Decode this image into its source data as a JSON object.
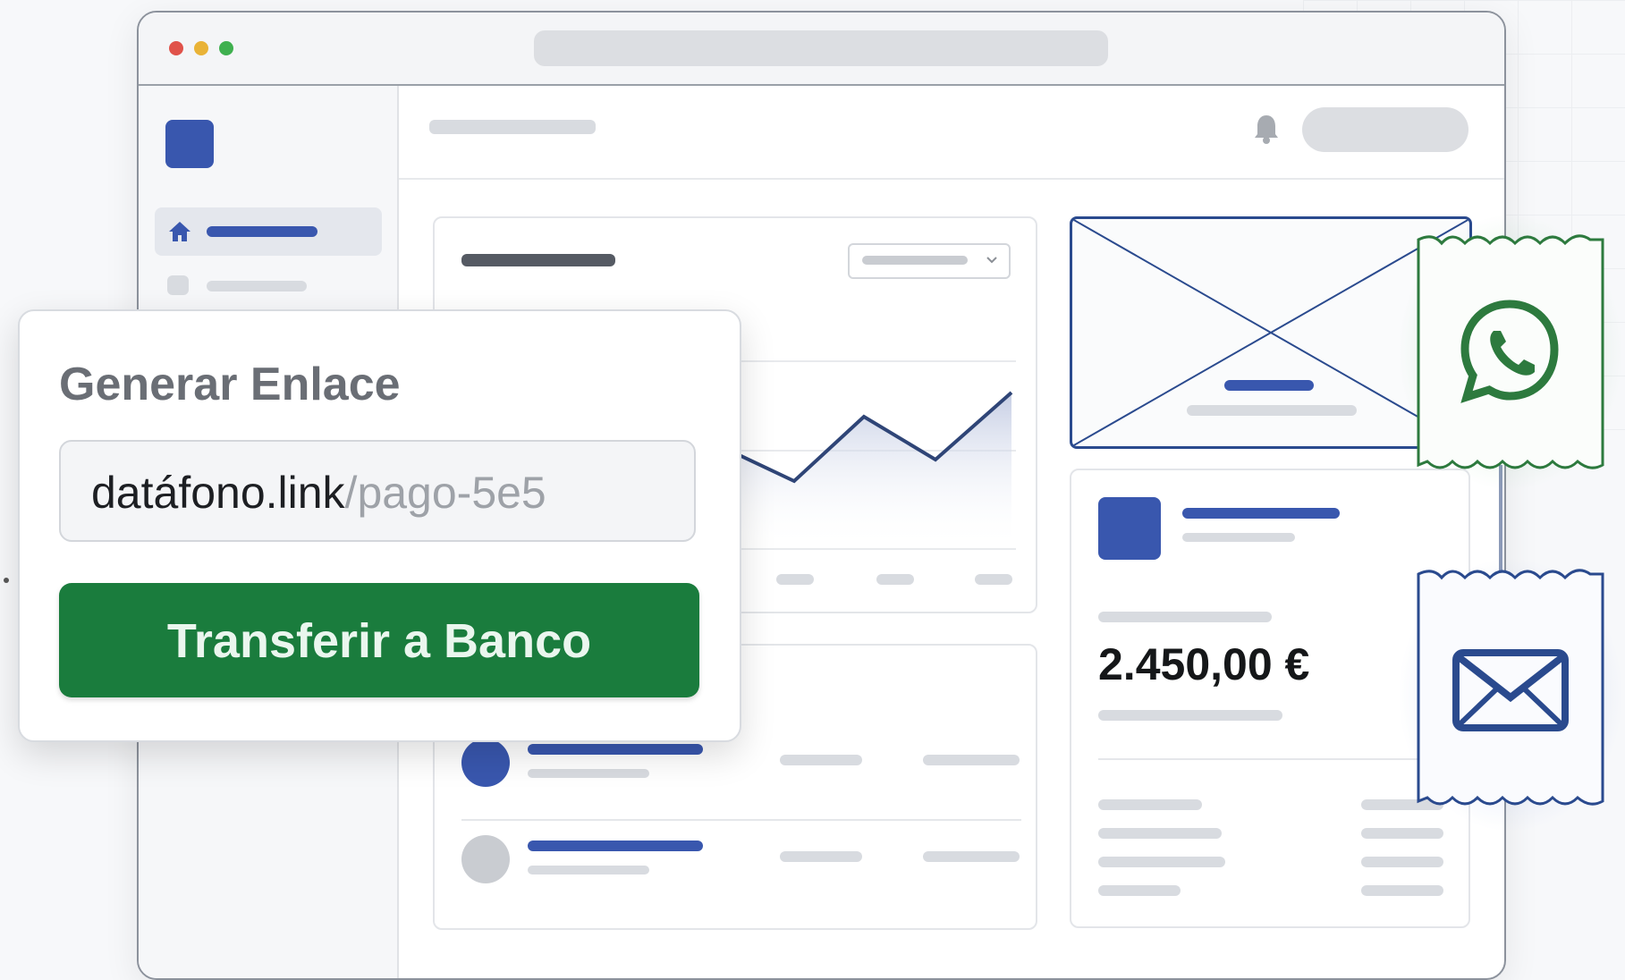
{
  "popup": {
    "title": "Generar Enlace",
    "link_domain": "datáfono.link",
    "link_path": "/pago-5e5",
    "button_label": "Transferir a Banco"
  },
  "summary_card": {
    "amount": "2.450,00 €"
  },
  "icons": {
    "share_whatsapp": "whatsapp-icon",
    "share_email": "envelope-icon",
    "notifications": "bell-icon",
    "nav_home": "home-icon"
  },
  "colors": {
    "accent_blue": "#3957ae",
    "primary_green": "#1a7c3d",
    "whatsapp_green": "#2d7a3e",
    "email_blue": "#2a4a8e"
  }
}
